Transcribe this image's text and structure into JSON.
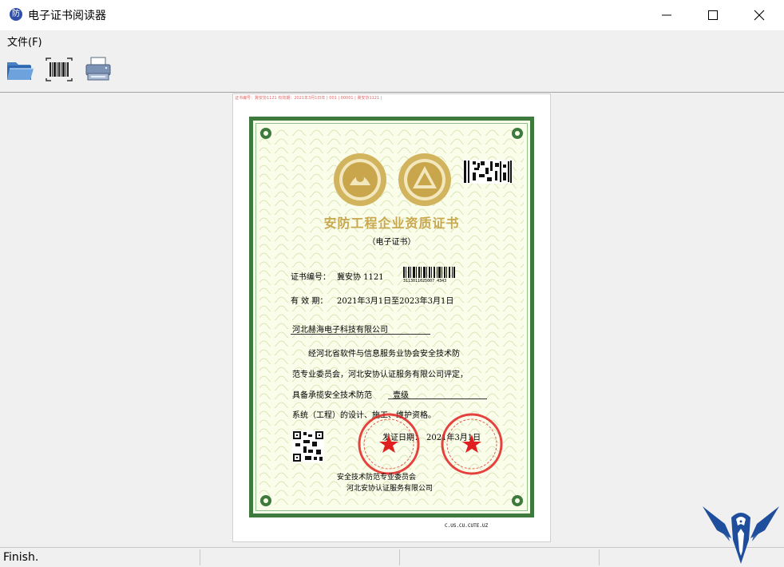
{
  "window": {
    "title": "电子证书阅读器",
    "app_icon_glyph": "防",
    "minimize_icon": "minimize-icon",
    "maximize_icon": "maximize-icon",
    "close_icon": "close-icon"
  },
  "menu": {
    "file": "文件(F)"
  },
  "toolbar": {
    "items": [
      {
        "icon": "open-folder-icon"
      },
      {
        "icon": "barcode-scan-icon"
      },
      {
        "icon": "printer-icon"
      }
    ]
  },
  "certificate": {
    "tiny_header": "证书编号：冀安协1121 有效期：2021年3月1日年 | 001 | 00001 | 冀安协1121 |",
    "title": "安防工程企业资质证书",
    "subtitle": "（电子证书）",
    "number_label": "证书编号：",
    "number_value": "冀安协 1121",
    "barcode_text": "3113011025007 4343",
    "validity_label": "有 效 期：",
    "validity_value": "2021年3月1日至2023年3月1日",
    "company": "河北赫海电子科技有限公司",
    "body_line1": "经河北省软件与信息服务业协会安全技术防",
    "body_line2": "范专业委员会，河北安协认证服务有限公司评定，",
    "body_line3_prefix": "具备承揽安全技术防范",
    "grade": "壹级",
    "body_line4": "系统（工程）的设计、施工、维护资格。",
    "issue_label": "发证日期：",
    "issue_date": "2021年3月1日",
    "issuer1": "安全技术防范专业委员会",
    "issuer2": "河北安协认证服务有限公司",
    "serial": "C.US.CU.CUTE.UZ"
  },
  "status": {
    "text": "Finish."
  },
  "colors": {
    "frame_green": "#3e7a3e",
    "title_gold": "#c8a84e",
    "seal_red": "#e02020",
    "eagle_blue": "#1f4f9c"
  }
}
